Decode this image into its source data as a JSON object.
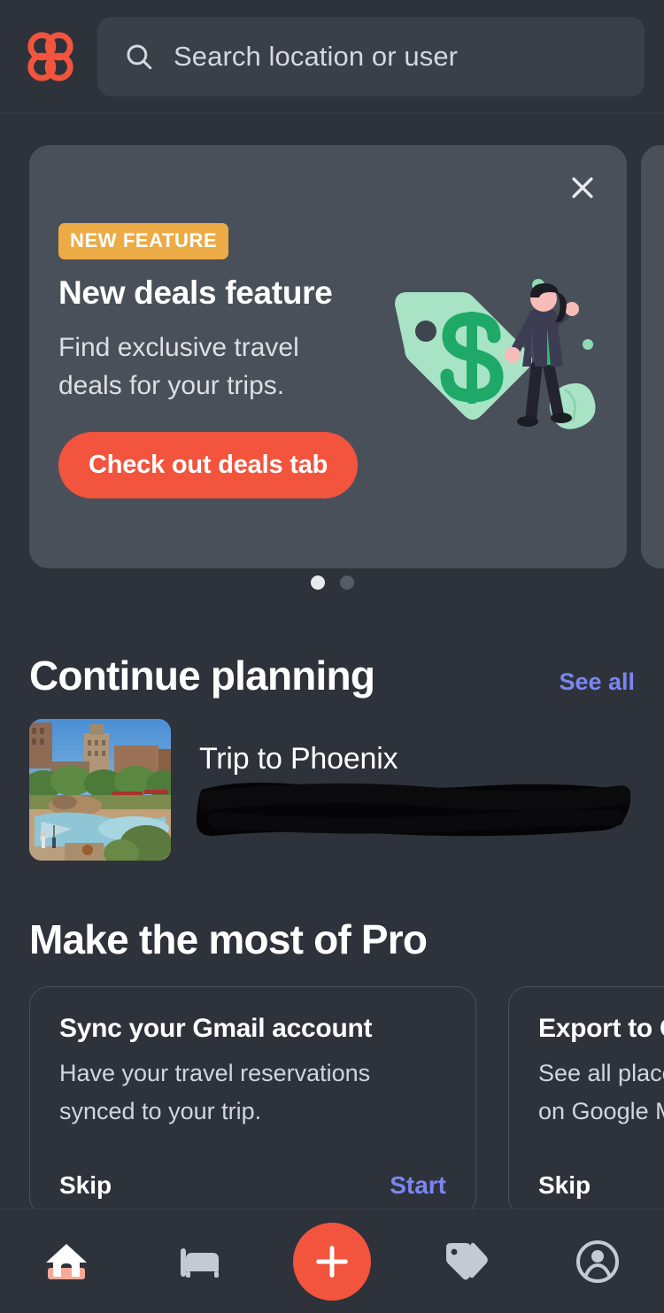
{
  "app": {
    "logo_icon": "butterfly-logo-icon",
    "brand_color": "#f2543d",
    "background_color": "#2e323a",
    "accent_link_color": "#7b86f0"
  },
  "header": {
    "search": {
      "placeholder": "Search location or user",
      "value": "",
      "icon": "search-icon"
    }
  },
  "promo": {
    "close_icon": "close-icon",
    "badge": "NEW FEATURE",
    "badge_color": "#edab45",
    "title": "New deals feature",
    "description": "Find exclusive travel deals for your trips.",
    "cta": "Check out deals tab",
    "illustration": "price-tag-dollar-illustration",
    "dots": [
      {
        "active": true
      },
      {
        "active": false
      }
    ]
  },
  "continue_planning": {
    "title": "Continue planning",
    "see_all": "See all",
    "trip": {
      "name": "Trip to Phoenix",
      "thumbnail": "phoenix-resort-photo",
      "subtitle_redacted": true
    }
  },
  "pro_section": {
    "title": "Make the most of Pro",
    "cards": [
      {
        "title": "Sync your Gmail account",
        "desc_line1": "Have your travel reservations",
        "desc_line2": "synced to your trip.",
        "skip": "Skip",
        "action": "Start"
      },
      {
        "title": "Export to G",
        "desc_line1": "See all place",
        "desc_line2": "on Google M",
        "skip": "Skip",
        "action": ""
      }
    ]
  },
  "bottom_nav": {
    "items": [
      {
        "name": "home",
        "icon": "home-icon",
        "active": true
      },
      {
        "name": "stays",
        "icon": "bed-icon",
        "active": false
      },
      {
        "name": "create",
        "icon": "plus-icon",
        "active": false
      },
      {
        "name": "deals",
        "icon": "tags-icon",
        "active": false
      },
      {
        "name": "account",
        "icon": "account-circle-icon",
        "active": false
      }
    ],
    "active_indicator_color": "#f7a896"
  }
}
